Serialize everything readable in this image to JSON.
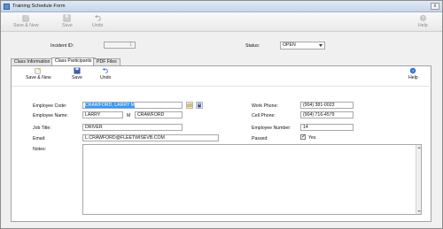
{
  "window": {
    "title": "Training Schedule Form",
    "close_glyph": "x"
  },
  "toolbar": {
    "save_new": "Save & New",
    "save": "Save",
    "undo": "Undo",
    "help": "Help"
  },
  "header": {
    "incident_label": "Incident ID:",
    "incident_value": "1",
    "status_label": "Status:",
    "status_value": "OPEN"
  },
  "tabs": [
    {
      "label": "Class Information"
    },
    {
      "label": "Class Participants"
    },
    {
      "label": "PDF Files"
    }
  ],
  "panel_toolbar": {
    "save_new": "Save & New",
    "save": "Save",
    "undo": "Undo",
    "help": "Help"
  },
  "form": {
    "employee_code_label": "Employee Code:",
    "employee_code_value": "CRAWFORD, LARRY M",
    "employee_name_label": "Employee Name:",
    "first_name": "LARRY",
    "middle_initial": "M",
    "last_name": "CRAWFORD",
    "job_title_label": "Job Title:",
    "job_title_value": "DRIVER",
    "email_label": "Email:",
    "email_value": "L.CRAWFORD@FLEETWISEVB.COM",
    "notes_label": "Notes:",
    "work_phone_label": "Work Phone:",
    "work_phone_value": "(904) 381-0023",
    "cell_phone_label": "Cell Phone:",
    "cell_phone_value": "(904) 716-4579",
    "employee_number_label": "Employee Number:",
    "employee_number_value": "14",
    "passed_label": "Passed:",
    "passed_checkbox_label": "Yes",
    "passed_checked": "✓"
  },
  "icons": [
    "save-new-icon",
    "save-icon",
    "undo-icon",
    "help-icon",
    "lookup-icon",
    "edit-icon"
  ],
  "colors": {
    "selection": "#3399ff",
    "title_bar": "#c6d6ea",
    "help_blue": "#2f6fd6"
  }
}
